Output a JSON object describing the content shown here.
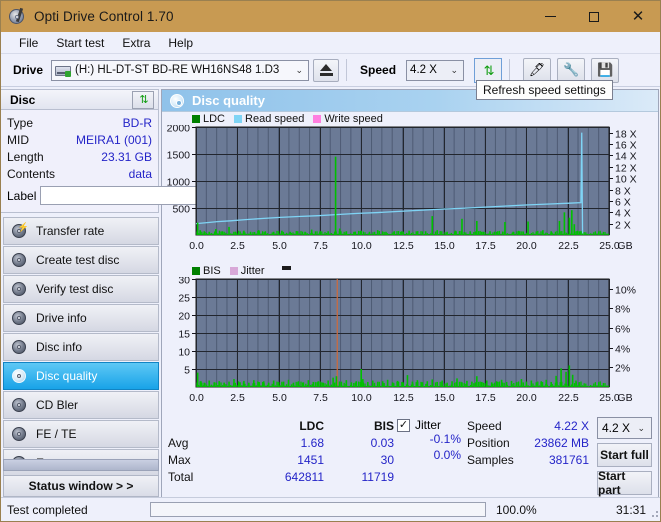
{
  "window": {
    "title": "Opti Drive Control 1.70",
    "minimize_label": "Minimize",
    "maximize_label": "Maximize",
    "close_label": "Close"
  },
  "menu": {
    "items": [
      "File",
      "Start test",
      "Extra",
      "Help"
    ]
  },
  "toolbar": {
    "drive_label": "Drive",
    "drive_value": "(H:)  HL-DT-ST BD-RE  WH16NS48 1.D3",
    "eject_label": "Eject",
    "speed_label": "Speed",
    "speed_value": "4.2 X",
    "refresh_tooltip": "Refresh speed settings",
    "erase_label": "Erase",
    "tools_label": "Tools",
    "save_label": "Save"
  },
  "sidebar": {
    "disc_header": "Disc",
    "disc_fields": [
      {
        "key": "Type",
        "value": "BD-R"
      },
      {
        "key": "MID",
        "value": "MEIRA1 (001)"
      },
      {
        "key": "Length",
        "value": "23.31 GB"
      },
      {
        "key": "Contents",
        "value": "data"
      }
    ],
    "label_key": "Label",
    "label_value": "",
    "label_placeholder": "",
    "nav": [
      {
        "label": "Transfer rate",
        "active": false
      },
      {
        "label": "Create test disc",
        "active": false
      },
      {
        "label": "Verify test disc",
        "active": false
      },
      {
        "label": "Drive info",
        "active": false
      },
      {
        "label": "Disc info",
        "active": false
      },
      {
        "label": "Disc quality",
        "active": true
      },
      {
        "label": "CD Bler",
        "active": false
      },
      {
        "label": "FE / TE",
        "active": false
      },
      {
        "label": "Extra tests",
        "active": false
      }
    ],
    "status_window_button": "Status window > >"
  },
  "panel": {
    "title": "Disc quality"
  },
  "stats": {
    "col_headers": [
      "",
      "LDC",
      "BIS"
    ],
    "rows": [
      {
        "label": "Avg",
        "ldc": "1.68",
        "bis": "0.03"
      },
      {
        "label": "Max",
        "ldc": "1451",
        "bis": "30"
      },
      {
        "label": "Total",
        "ldc": "642811",
        "bis": "11719"
      }
    ],
    "jitter_checkbox_label": "Jitter",
    "jitter_checked": true,
    "jitter_values": [
      "-0.1%",
      "0.0%"
    ],
    "speed_label": "Speed",
    "speed_value": "4.22 X",
    "position_label": "Position",
    "position_value": "23862 MB",
    "samples_label": "Samples",
    "samples_value": "381761",
    "speed_select_value": "4.2 X",
    "start_full_label": "Start full",
    "start_part_label": "Start part"
  },
  "statusbar": {
    "message": "Test completed",
    "percent_label": "100.0%",
    "percent_value": 100,
    "elapsed": "31:31"
  },
  "colors": {
    "title_bar": "#c89a52",
    "accent": "#18a3e8",
    "ldc_green": "#00c000",
    "bis_green": "#00c000",
    "read_speed": "#7fd4f5",
    "write_speed": "#ff7fe0",
    "jitter_pink": "#d8a8d8",
    "plot_bg": "#6b7a96",
    "value_blue": "#2424c8",
    "progress_green": "#00b400"
  },
  "chart_data": [
    {
      "type": "line",
      "id": "ldc-chart",
      "title": "",
      "legend": [
        {
          "name": "LDC",
          "color": "#008000",
          "kind": "bar"
        },
        {
          "name": "Read speed",
          "color": "#7fd4f5",
          "kind": "line"
        },
        {
          "name": "Write speed",
          "color": "#ff7fe0",
          "kind": "line"
        }
      ],
      "legend_position": "top-left",
      "xlabel": "GB",
      "x_ticks": [
        "0.0",
        "2.5",
        "5.0",
        "7.5",
        "10.0",
        "12.5",
        "15.0",
        "17.5",
        "20.0",
        "22.5",
        "25.0"
      ],
      "xlim": [
        0,
        25
      ],
      "ylabel_left": "LDC",
      "y_ticks_left": [
        "500",
        "1000",
        "1500",
        "2000"
      ],
      "ylim_left": [
        0,
        2000
      ],
      "ylabel_right": "Speed",
      "y_ticks_right": [
        "2 X",
        "4 X",
        "6 X",
        "8 X",
        "10 X",
        "12 X",
        "14 X",
        "16 X",
        "18 X"
      ],
      "ylim_right": [
        0,
        19
      ],
      "grid": true,
      "series": [
        {
          "name": "Read speed",
          "color": "#7fd4f5",
          "axis": "right",
          "x": [
            0.0,
            0.6,
            1.3,
            2.1,
            3.0,
            4.0,
            5.1,
            6.2,
            7.4,
            8.6,
            9.8,
            11.0,
            12.3,
            13.6,
            14.9,
            16.2,
            17.5,
            18.8,
            20.1,
            21.4,
            22.6,
            23.3,
            23.35,
            23.4
          ],
          "values": [
            2.0,
            2.15,
            2.35,
            2.5,
            2.7,
            2.9,
            3.1,
            3.25,
            3.4,
            3.6,
            3.8,
            3.95,
            4.15,
            4.35,
            4.55,
            4.7,
            4.9,
            5.1,
            5.3,
            5.45,
            5.6,
            5.7,
            18.0,
            0.0
          ]
        },
        {
          "name": "LDC",
          "color": "#00c000",
          "axis": "left",
          "comment": "error spikes sampled across the disc",
          "x": [
            0.1,
            0.25,
            0.5,
            0.8,
            1.2,
            1.6,
            2.0,
            2.4,
            2.9,
            3.3,
            3.8,
            4.2,
            4.7,
            5.2,
            5.7,
            6.1,
            6.6,
            7.0,
            7.5,
            8.0,
            8.45,
            8.7,
            9.1,
            9.6,
            10.0,
            10.5,
            11.0,
            11.5,
            12.0,
            12.4,
            12.9,
            13.4,
            13.9,
            14.3,
            14.6,
            15.2,
            15.7,
            16.1,
            16.6,
            17.0,
            17.3,
            17.8,
            18.2,
            18.7,
            19.2,
            19.6,
            20.1,
            20.6,
            21.0,
            21.5,
            22.0,
            22.3,
            22.6,
            22.75,
            22.9,
            23.1,
            23.3
          ],
          "values": [
            230,
            90,
            70,
            60,
            110,
            70,
            150,
            60,
            80,
            60,
            90,
            70,
            60,
            80,
            60,
            70,
            60,
            100,
            60,
            70,
            1451,
            120,
            70,
            60,
            80,
            60,
            90,
            60,
            70,
            60,
            80,
            60,
            70,
            350,
            90,
            60,
            80,
            300,
            70,
            260,
            60,
            70,
            60,
            240,
            60,
            70,
            250,
            60,
            90,
            70,
            260,
            420,
            320,
            460,
            200,
            80,
            60
          ]
        }
      ]
    },
    {
      "type": "line",
      "id": "bis-chart",
      "title": "",
      "legend": [
        {
          "name": "BIS",
          "color": "#008000",
          "kind": "bar"
        },
        {
          "name": "Jitter",
          "color": "#d8a8d8",
          "kind": "line"
        }
      ],
      "legend_position": "top-left",
      "xlabel": "GB",
      "x_ticks": [
        "0.0",
        "2.5",
        "5.0",
        "7.5",
        "10.0",
        "12.5",
        "15.0",
        "17.5",
        "20.0",
        "22.5",
        "25.0"
      ],
      "xlim": [
        0,
        25
      ],
      "ylabel_left": "BIS",
      "y_ticks_left": [
        "5",
        "10",
        "15",
        "20",
        "25",
        "30"
      ],
      "ylim_left": [
        0,
        30
      ],
      "ylabel_right": "Jitter",
      "y_ticks_right": [
        "2%",
        "4%",
        "6%",
        "8%",
        "10%"
      ],
      "ylim_right": [
        0,
        11
      ],
      "grid": true,
      "series": [
        {
          "name": "BIS",
          "color": "#00c000",
          "axis": "left",
          "x": [
            0.1,
            0.3,
            0.5,
            0.8,
            1.1,
            1.4,
            1.7,
            2.0,
            2.3,
            2.6,
            2.9,
            3.2,
            3.5,
            3.8,
            4.1,
            4.4,
            4.7,
            5.0,
            5.3,
            5.6,
            5.9,
            6.2,
            6.5,
            6.8,
            7.1,
            7.4,
            7.7,
            8.0,
            8.3,
            8.5,
            8.8,
            9.1,
            9.4,
            9.7,
            10.0,
            10.1,
            10.4,
            10.7,
            11.0,
            11.3,
            11.6,
            11.9,
            12.2,
            12.5,
            12.8,
            13.1,
            13.4,
            13.7,
            14.0,
            14.3,
            14.6,
            14.9,
            15.2,
            15.5,
            15.8,
            16.1,
            16.4,
            16.7,
            17.0,
            17.3,
            17.6,
            17.9,
            18.2,
            18.5,
            18.8,
            19.1,
            19.4,
            19.7,
            20.0,
            20.3,
            20.6,
            20.9,
            21.2,
            21.5,
            21.8,
            22.1,
            22.4,
            22.6,
            22.8,
            23.0,
            23.2
          ],
          "values": [
            4.0,
            1.6,
            1.2,
            1.8,
            1.3,
            1.6,
            1.2,
            1.5,
            2.2,
            1.3,
            1.7,
            1.2,
            1.9,
            1.4,
            1.6,
            1.2,
            1.8,
            1.3,
            1.5,
            2.0,
            1.2,
            1.6,
            1.3,
            1.9,
            1.4,
            1.6,
            1.2,
            1.8,
            2.6,
            3.0,
            1.5,
            1.9,
            1.3,
            1.6,
            5.0,
            2.2,
            1.4,
            1.8,
            1.3,
            1.6,
            2.0,
            1.3,
            1.7,
            1.4,
            3.3,
            1.5,
            1.9,
            1.3,
            1.6,
            2.1,
            1.4,
            1.8,
            1.2,
            1.6,
            2.4,
            1.3,
            1.7,
            1.5,
            3.0,
            1.4,
            1.8,
            1.3,
            1.6,
            2.0,
            1.4,
            1.7,
            1.3,
            2.2,
            1.5,
            1.8,
            1.3,
            1.6,
            2.0,
            1.4,
            3.1,
            5.2,
            4.2,
            6.0,
            3.4,
            1.8,
            1.3
          ]
        },
        {
          "name": "Jitter",
          "color": "#d8a8d8",
          "axis": "right",
          "x": [],
          "values": []
        }
      ],
      "annotations": [
        {
          "type": "vline",
          "x": 8.55,
          "color": "#d06a3a",
          "label": "cursor"
        }
      ]
    }
  ]
}
